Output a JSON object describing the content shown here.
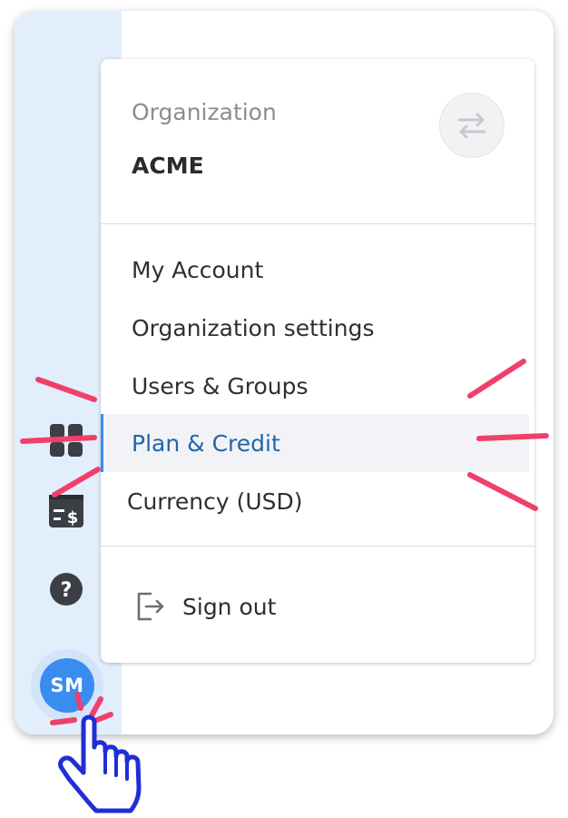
{
  "organization": {
    "label": "Organization",
    "name": "ACME",
    "switch_icon": "switch-arrows-icon"
  },
  "menu": {
    "items": [
      {
        "label": "My Account",
        "active": false
      },
      {
        "label": "Organization settings",
        "active": false
      },
      {
        "label": "Users & Groups",
        "active": false
      },
      {
        "label": "Plan & Credit",
        "active": true
      },
      {
        "label": "Currency (USD)",
        "active": false
      }
    ],
    "sign_out": "Sign out"
  },
  "sidebar": {
    "icons": [
      "grid-icon",
      "billing-icon",
      "help-icon"
    ],
    "avatar_initials": "SM"
  },
  "colors": {
    "sidebar_bg": "#e3eefc",
    "accent": "#3a8df0",
    "active_text": "#2465a8",
    "highlight_marks": "#f0406a",
    "pointer": "#1f2fd6"
  }
}
